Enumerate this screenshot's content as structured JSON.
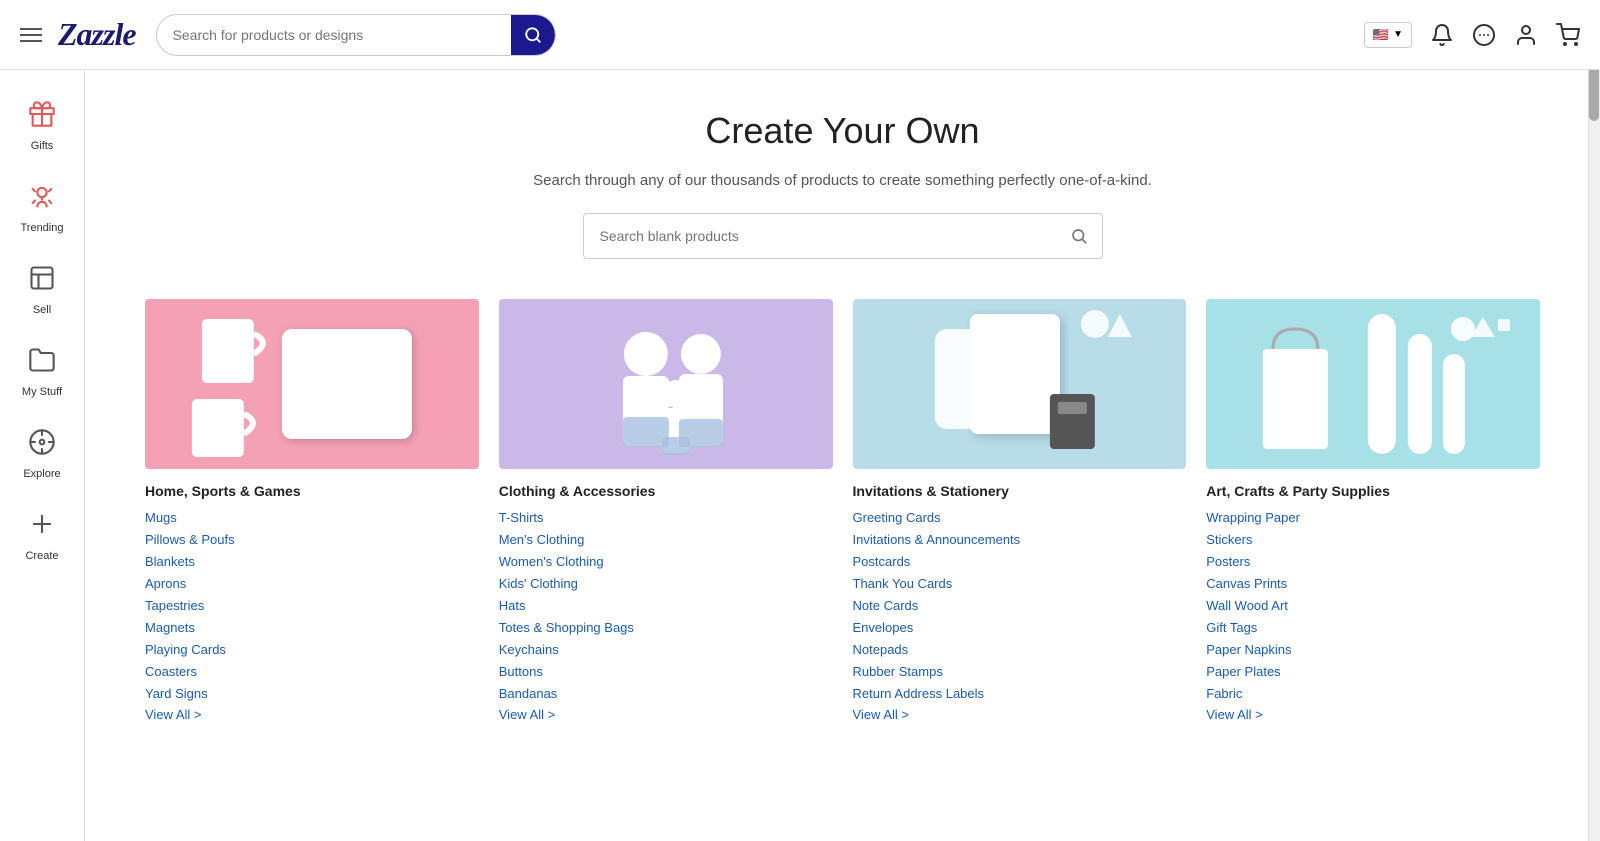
{
  "header": {
    "logo": "Zazzle",
    "search_placeholder": "Search for products or designs",
    "flag": "🇺🇸"
  },
  "sidebar": {
    "items": [
      {
        "id": "gifts",
        "label": "Gifts",
        "icon": "gift"
      },
      {
        "id": "trending",
        "label": "Trending",
        "icon": "trending"
      },
      {
        "id": "sell",
        "label": "Sell",
        "icon": "sell"
      },
      {
        "id": "my-stuff",
        "label": "My Stuff",
        "icon": "folder"
      },
      {
        "id": "explore",
        "label": "Explore",
        "icon": "explore"
      },
      {
        "id": "create",
        "label": "Create",
        "icon": "create"
      }
    ]
  },
  "main": {
    "page_title": "Create Your Own",
    "subtitle": "Search through any of our thousands of products to create something perfectly one-of-a-kind.",
    "search_blank_placeholder": "Search blank products",
    "categories": [
      {
        "id": "home-sports-games",
        "title": "Home, Sports & Games",
        "image_theme": "pink",
        "links": [
          "Mugs",
          "Pillows & Poufs",
          "Blankets",
          "Aprons",
          "Tapestries",
          "Magnets",
          "Playing Cards",
          "Coasters",
          "Yard Signs"
        ],
        "view_all": "View All >"
      },
      {
        "id": "clothing-accessories",
        "title": "Clothing & Accessories",
        "image_theme": "purple",
        "links": [
          "T-Shirts",
          "Men's Clothing",
          "Women's Clothing",
          "Kids' Clothing",
          "Hats",
          "Totes & Shopping Bags",
          "Keychains",
          "Buttons",
          "Bandanas"
        ],
        "view_all": "View All >"
      },
      {
        "id": "invitations-stationery",
        "title": "Invitations & Stationery",
        "image_theme": "light-blue",
        "links": [
          "Greeting Cards",
          "Invitations & Announcements",
          "Postcards",
          "Thank You Cards",
          "Note Cards",
          "Envelopes",
          "Notepads",
          "Rubber Stamps",
          "Return Address Labels"
        ],
        "view_all": "View All >"
      },
      {
        "id": "art-crafts-party",
        "title": "Art, Crafts & Party Supplies",
        "image_theme": "blue",
        "links": [
          "Wrapping Paper",
          "Stickers",
          "Posters",
          "Canvas Prints",
          "Wall Wood Art",
          "Gift Tags",
          "Paper Napkins",
          "Paper Plates",
          "Fabric"
        ],
        "view_all": "View All >"
      }
    ]
  }
}
